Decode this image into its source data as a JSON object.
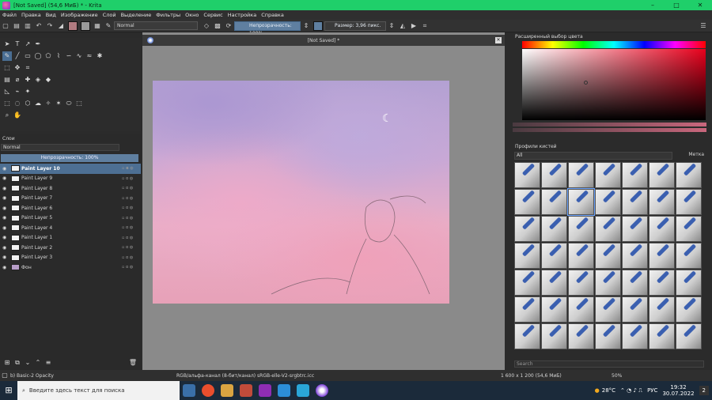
{
  "window": {
    "title": "[Not Saved]  (54,6 МиБ)  * - Krita"
  },
  "menu": [
    "Файл",
    "Правка",
    "Вид",
    "Изображение",
    "Слой",
    "Выделение",
    "Фильтры",
    "Окно",
    "Сервис",
    "Настройка",
    "Справка"
  ],
  "toolbar": {
    "blend_mode": "Normal",
    "opacity": "Непрозрачность: 100%",
    "size": "Размер: 3,96 пикс."
  },
  "document": {
    "tab": "[Not Saved]  *"
  },
  "layers": {
    "title": "Слои",
    "blend_mode": "Normal",
    "opacity": "Непрозрачность:  100%",
    "items": [
      {
        "name": "Paint Layer 10"
      },
      {
        "name": "Paint Layer 9"
      },
      {
        "name": "Paint Layer 8"
      },
      {
        "name": "Paint Layer 7"
      },
      {
        "name": "Paint Layer 6"
      },
      {
        "name": "Paint Layer 5"
      },
      {
        "name": "Paint Layer 4"
      },
      {
        "name": "Paint Layer 1"
      },
      {
        "name": "Paint Layer 2"
      },
      {
        "name": "Paint Layer 3"
      },
      {
        "name": "Фон"
      }
    ]
  },
  "color_panel": {
    "title": "Расширенный выбор цвета"
  },
  "brush_panel": {
    "title": "Профили кистей",
    "filter": "All",
    "tag": "Метка",
    "search_placeholder": "Search"
  },
  "status": {
    "brush": "b) Basic-2 Opacity",
    "colorspace": "RGB/альфа-канал (8-бит/канал)  sRGB-elle-V2-srgbtrc.icc",
    "size": "1 600 x 1 200 (54,6 МиБ)",
    "zoom": "50%"
  },
  "taskbar": {
    "search": "Введите здесь текст для поиска",
    "weather": "28°C",
    "lang": "РУС",
    "time": "19:32",
    "date": "30.07.2022",
    "notifications": "2"
  }
}
